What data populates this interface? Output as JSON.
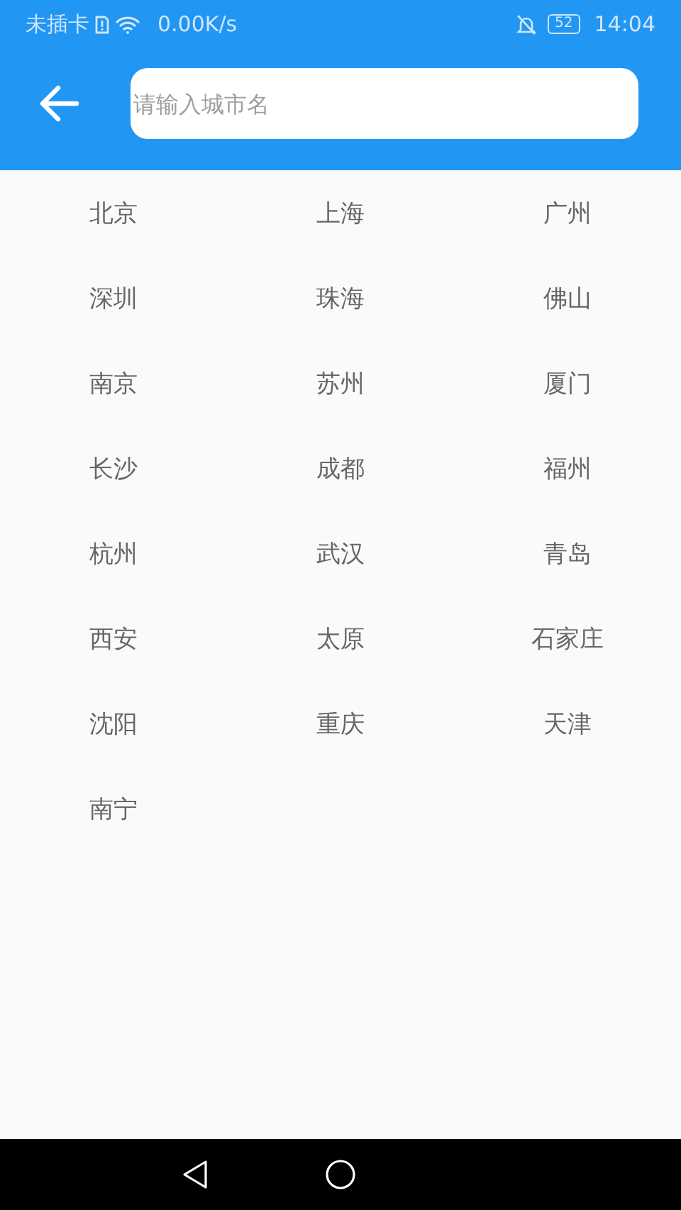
{
  "status_bar": {
    "carrier": "未插卡",
    "speed": "0.00K/s",
    "battery": "52",
    "time": "14:04"
  },
  "search": {
    "placeholder": "请输入城市名"
  },
  "cities": [
    "北京",
    "上海",
    "广州",
    "深圳",
    "珠海",
    "佛山",
    "南京",
    "苏州",
    "厦门",
    "长沙",
    "成都",
    "福州",
    "杭州",
    "武汉",
    "青岛",
    "西安",
    "太原",
    "石家庄",
    "沈阳",
    "重庆",
    "天津",
    "南宁"
  ]
}
